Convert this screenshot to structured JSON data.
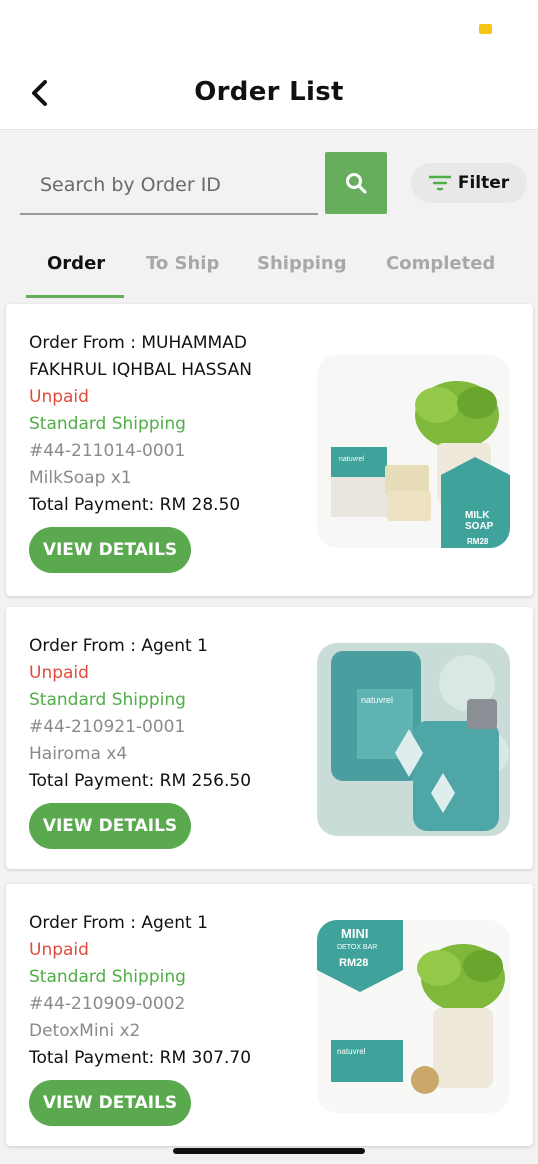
{
  "header": {
    "title": "Order List"
  },
  "search": {
    "placeholder": "Search by Order ID",
    "filter_label": "Filter"
  },
  "tabs": [
    {
      "label": "Order",
      "active": true
    },
    {
      "label": "To Ship",
      "active": false
    },
    {
      "label": "Shipping",
      "active": false
    },
    {
      "label": "Completed",
      "active": false
    }
  ],
  "orders": [
    {
      "from": "Order From : MUHAMMAD FAKHRUL IQHBAL HASSAN",
      "status": "Unpaid",
      "shipping": "Standard Shipping",
      "order_id": "#44-211014-0001",
      "product": "MilkSoap x1",
      "total": "Total Payment: RM 28.50",
      "button": "VIEW DETAILS",
      "image": {
        "brand": "natuvrel",
        "label_line1": "MILK",
        "label_line2": "SOAP",
        "price": "RM28"
      }
    },
    {
      "from": "Order From : Agent 1",
      "status": "Unpaid",
      "shipping": "Standard Shipping",
      "order_id": "#44-210921-0001",
      "product": "Hairoma x4",
      "total": "Total Payment: RM 256.50",
      "button": "VIEW DETAILS",
      "image": {
        "brand": "natuvrel"
      }
    },
    {
      "from": "Order From : Agent 1",
      "status": "Unpaid",
      "shipping": "Standard Shipping",
      "order_id": "#44-210909-0002",
      "product": "DetoxMini x2",
      "total": "Total Payment: RM 307.70",
      "button": "VIEW DETAILS",
      "image": {
        "brand": "natuvrel",
        "label_line1": "MINI",
        "label_line2": "DETOX BAR",
        "price": "RM28"
      }
    }
  ],
  "colors": {
    "accent": "#66ad5c",
    "unpaid": "#e24a3b",
    "shipping": "#4fae45",
    "muted": "#8a8a8a"
  },
  "icons": {
    "back": "chevron-left-icon",
    "search": "search-icon",
    "filter": "filter-icon"
  }
}
